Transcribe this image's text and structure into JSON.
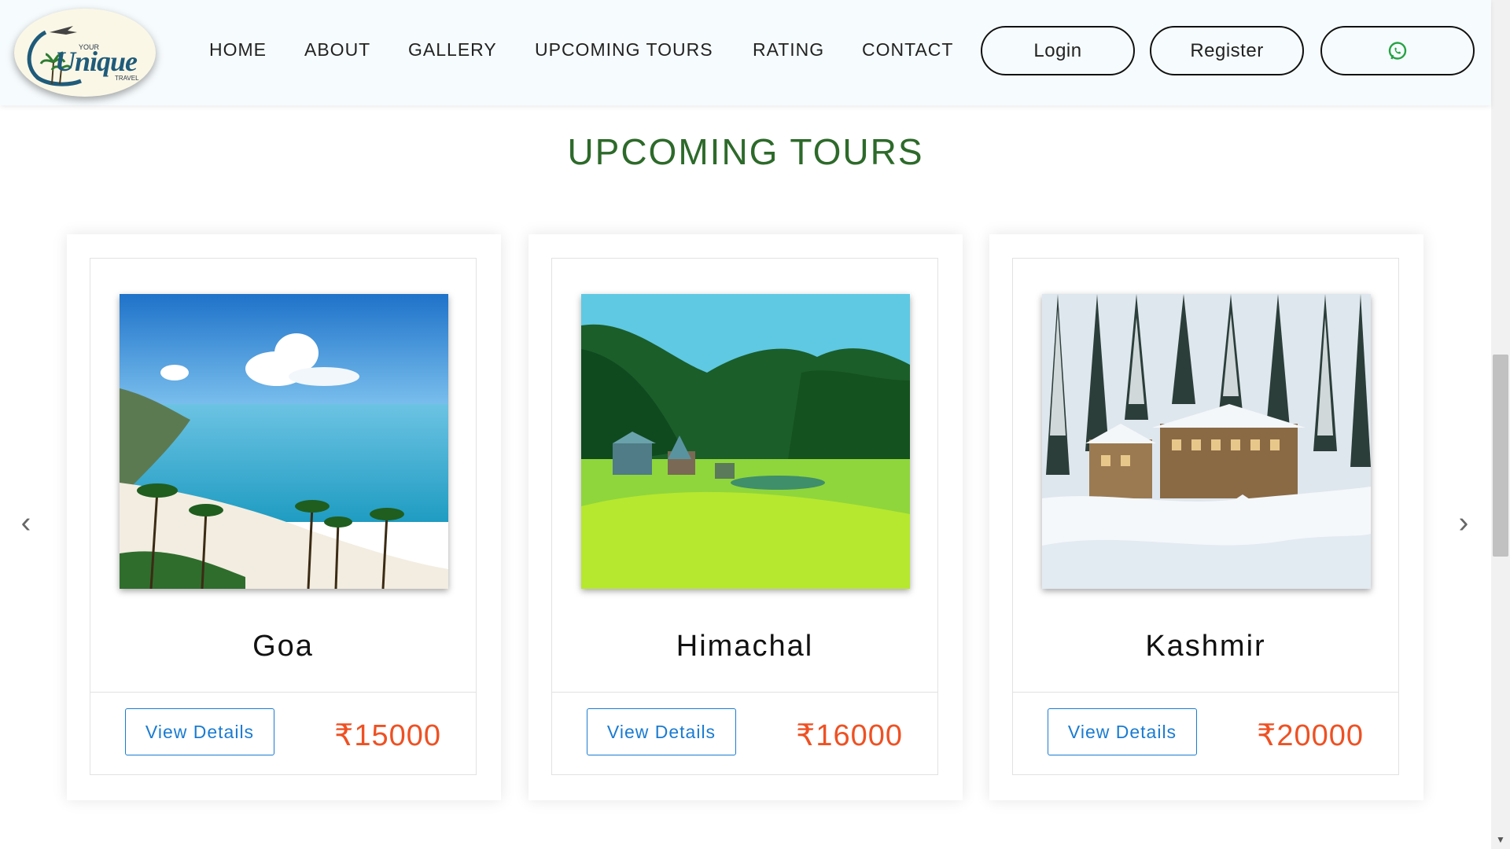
{
  "logo": {
    "line1": "YOUR",
    "main": "Unique",
    "line3": "TRAVEL"
  },
  "nav": {
    "items": [
      "HOME",
      "ABOUT",
      "GALLERY",
      "UPCOMING TOURS",
      "RATING",
      "CONTACT"
    ]
  },
  "header_buttons": {
    "login": "Login",
    "register": "Register",
    "whatsapp_icon": "whatsapp-icon"
  },
  "section": {
    "title": "UPCOMING TOURS"
  },
  "carousel": {
    "prev_icon": "‹",
    "next_icon": "›"
  },
  "tours": [
    {
      "name": "Goa",
      "button": "View Details",
      "price": "₹15000",
      "image": "beach-photo"
    },
    {
      "name": "Himachal",
      "button": "View Details",
      "price": "₹16000",
      "image": "mountain-meadow-photo"
    },
    {
      "name": "Kashmir",
      "button": "View Details",
      "price": "₹20000",
      "image": "snow-hotel-photo"
    }
  ],
  "colors": {
    "title": "#2d6a2a",
    "price": "#ee5123",
    "button": "#1a7bd1",
    "whatsapp": "#25a244"
  }
}
